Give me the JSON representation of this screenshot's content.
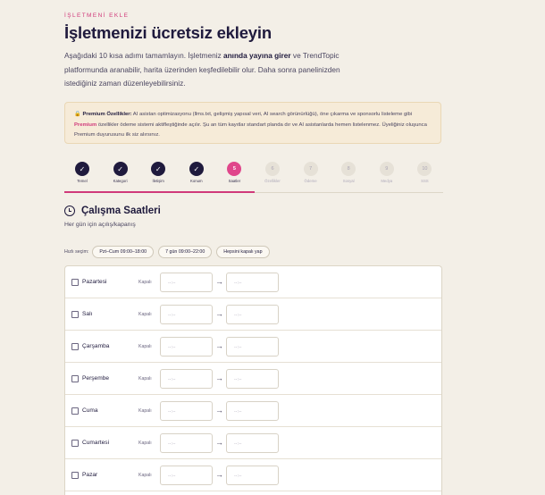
{
  "header": {
    "eyebrow": "İŞLETMENİ EKLE",
    "title": "İşletmenizi ücretsiz ekleyin",
    "intro_1": "Aşağıdaki 10 kısa adımı tamamlayın. İşletmeniz ",
    "intro_bold": "anında yayına girer",
    "intro_2": " ve TrendTopic platformunda aranabilir, harita üzerinden keşfedilebilir olur. Daha sonra panelinizden istediğiniz zaman düzenleyebilirsiniz."
  },
  "notice": {
    "icon": "lock-icon",
    "label": "Premium Özellikler:",
    "text_1": " AI asistan optimizasyonu (llms.txt, gelişmiş yapısal veri, AI search görünürlüğü), öne çıkarma ve sponsorlu listeleme gibi ",
    "premium": "Premium",
    "text_2": " özellikler ödeme sistemi aktifleştiğinde açılır. Şu an tüm kayıtlar standart planda dır ve AI asistanlarda hemen listelenmez. Üyeliğiniz oluşunca Premium duyurusunu ilk siz alırsınız."
  },
  "steps": [
    {
      "num": "✓",
      "label": "Temel",
      "state": "done"
    },
    {
      "num": "✓",
      "label": "Kategori",
      "state": "done"
    },
    {
      "num": "✓",
      "label": "İletişim",
      "state": "done"
    },
    {
      "num": "✓",
      "label": "Konum",
      "state": "done"
    },
    {
      "num": "5",
      "label": "Saatler",
      "state": "active"
    },
    {
      "num": "6",
      "label": "Özellikler",
      "state": "todo"
    },
    {
      "num": "7",
      "label": "Ödeme",
      "state": "todo"
    },
    {
      "num": "8",
      "label": "Sosyal",
      "state": "todo"
    },
    {
      "num": "9",
      "label": "Medya",
      "state": "todo"
    },
    {
      "num": "10",
      "label": "SSS",
      "state": "todo"
    }
  ],
  "section": {
    "icon": "clock-icon",
    "title": "Çalışma Saatleri",
    "subtitle": "Her gün için açılış/kapanış"
  },
  "quick": {
    "label": "Hızlı seçim:",
    "chips": [
      "Pzt–Cum 09:00–18:00",
      "7 gün 09:00–22:00",
      "Hepsini kapalı yap"
    ]
  },
  "hours": {
    "closed_label": "Kapalı",
    "time_placeholder": "--:--",
    "arrow": "→",
    "days": [
      "Pazartesi",
      "Salı",
      "Çarşamba",
      "Perşembe",
      "Cuma",
      "Cumartesi",
      "Pazar"
    ]
  },
  "colors": {
    "background": "#f3efe7",
    "navy": "#1f1a3d",
    "accent": "#d0397a",
    "active_step": "#e0468b"
  }
}
